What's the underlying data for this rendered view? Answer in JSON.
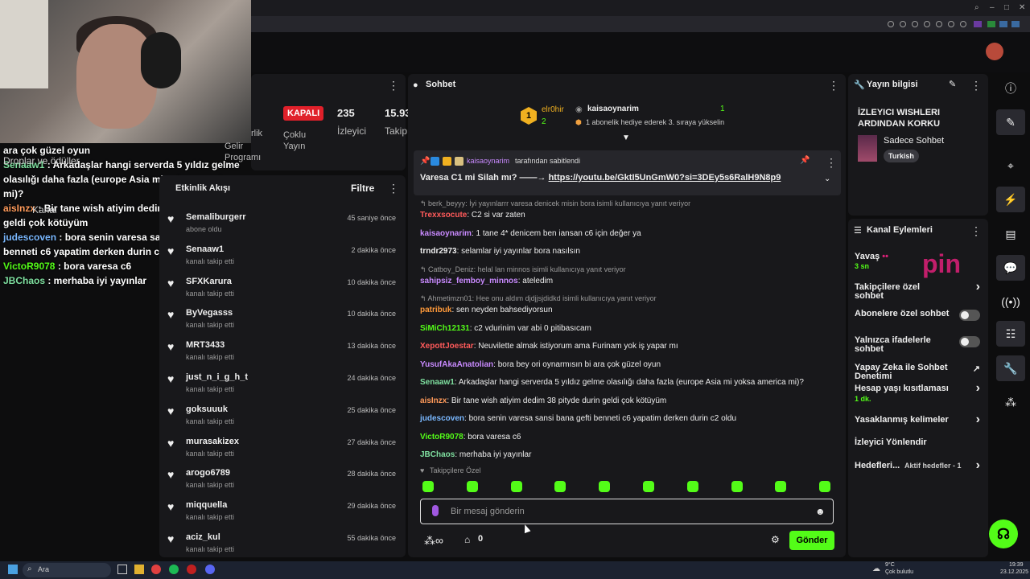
{
  "overlay_chat": [
    {
      "user": "",
      "text": "ara çok güzel oyun",
      "color": "#ffffff"
    },
    {
      "user": "Senaaw1",
      "text": " : Arkadaşlar hangi serverda 5 yıldız gelme olasılığı daha fazla (europe Asia mi yoksa america mi)?",
      "color": "#7fe0a0"
    },
    {
      "user": "aisInzx",
      "text": " : Bir tane wish atiyim dedim 38 pityde durin geldi çok kötüyüm",
      "color": "#ff9a5a"
    },
    {
      "user": "judescoven",
      "text": " : bora senin varesa sansi bana gefti benneti c6 yapatim derken durin c2 oldu",
      "color": "#7ab8ff"
    },
    {
      "user": "VictoR9078",
      "text": " : bora varesa c6",
      "color": "#53fc18"
    },
    {
      "user": "JBChaos",
      "text": " : merhaba iyi yayınlar",
      "color": "#7fe0a0"
    }
  ],
  "overlay_under": {
    "drops": "Droplar ve ödüller",
    "kanal": "Kanal"
  },
  "stats": {
    "status": "KAPALI",
    "viewers_num": "235",
    "viewers_label": "İzleyici",
    "followers_num": "15.93",
    "followers_label": "Takip",
    "partial_label": "rlik",
    "cok_label": "Çoklu\nYayın",
    "gelir_label": "Gelir\nProgramı"
  },
  "activity": {
    "title": "Etkinlik Akışı",
    "filter": "Filtre",
    "rows": [
      {
        "name": "Semaliburgerr",
        "sub": "abone oldu",
        "time": "45 saniye önce"
      },
      {
        "name": "Senaaw1",
        "sub": "kanalı takip etti",
        "time": "2 dakika önce"
      },
      {
        "name": "SFXKarura",
        "sub": "kanalı takip etti",
        "time": "10 dakika önce"
      },
      {
        "name": "ByVegasss",
        "sub": "kanalı takip etti",
        "time": "10 dakika önce"
      },
      {
        "name": "MRT3433",
        "sub": "kanalı takip etti",
        "time": "13 dakika önce"
      },
      {
        "name": "just_n_i_g_h_t",
        "sub": "kanalı takip etti",
        "time": "24 dakika önce"
      },
      {
        "name": "goksuuuk",
        "sub": "kanalı takip etti",
        "time": "25 dakika önce"
      },
      {
        "name": "murasakizex",
        "sub": "kanalı takip etti",
        "time": "27 dakika önce"
      },
      {
        "name": "arogo6789",
        "sub": "kanalı takip etti",
        "time": "28 dakika önce"
      },
      {
        "name": "miqquella",
        "sub": "kanalı takip etti",
        "time": "29 dakika önce"
      },
      {
        "name": "aciz_kul",
        "sub": "kanalı takip etti",
        "time": "55 dakika önce"
      }
    ]
  },
  "chat": {
    "title": "Sohbet",
    "top_gifter": "elr0hir",
    "top_gifter_count": "2",
    "gift_user": "kaisaoynarim",
    "gift_count": "1",
    "gift_text": "1 abonelik hediye ederek 3. sıraya yükselin",
    "pinned_by": "kaisaoynarim",
    "pinned_by_suffix": " tarafından sabitlendi",
    "pinned_text": "Varesa C1 mi Silah mı? ——→ ",
    "pinned_link": "https://youtu.be/GktI5UnGmW0?si=3DEy5s6RalH9N8p9",
    "messages": [
      {
        "type": "reply",
        "text": "berk_beyyy: İyi yayınlarrr varesa denicek misin bora isimli kullanıcıya yanıt veriyor"
      },
      {
        "type": "msg",
        "user": "Trexxsocute",
        "color": "#ff5a5a",
        "text": ": C2 si var zaten"
      },
      {
        "type": "msg",
        "user": "kaisaoynarim",
        "color": "#c98aff",
        "text": ": 1 tane 4* denicem ben iansan c6 için değer ya"
      },
      {
        "type": "msg",
        "user": "trndr2973",
        "color": "#eeeeee",
        "text": ": selamlar iyi yayınlar bora nasılsın"
      },
      {
        "type": "reply",
        "text": "Catboy_Deniz: helal lan minnos isimli kullanıcıya yanıt veriyor"
      },
      {
        "type": "msg",
        "user": "sahipsiz_femboy_minnos",
        "color": "#c98aff",
        "text": ": ateledim"
      },
      {
        "type": "reply",
        "text": "Ahmetimzn01: Hee onu aldım djdjjsjdidkd isimli kullanıcıya yanıt veriyor"
      },
      {
        "type": "msg",
        "user": "patribuk",
        "color": "#ff9a3a",
        "text": ": sen neyden bahsediyorsun"
      },
      {
        "type": "msg",
        "user": "SiMiCh12131",
        "color": "#53fc18",
        "text": ": c2 vdurinim var abi 0 pitibasıcam"
      },
      {
        "type": "msg",
        "user": "XepottJoestar",
        "color": "#ff5a5a",
        "text": ": Neuvilette almak istiyorum ama Furinam yok iş yapar mı"
      },
      {
        "type": "msg",
        "user": "YusufAkaAnatolian",
        "color": "#c98aff",
        "text": ": bora bey ori oynarmısın bi ara çok güzel oyun"
      },
      {
        "type": "msg",
        "user": "Senaaw1",
        "color": "#7fe0a0",
        "text": ": Arkadaşlar hangi serverda 5 yıldız gelme olasılığı daha fazla (europe Asia mi yoksa america mi)?"
      },
      {
        "type": "msg",
        "user": "aisInzx",
        "color": "#ff9a5a",
        "text": ": Bir tane wish atiyim dedim 38 pityde durin geldi çok kötüyüm"
      },
      {
        "type": "msg",
        "user": "judescoven",
        "color": "#7ab8ff",
        "text": ": bora senin varesa sansi bana gefti benneti c6 yapatim derken durin c2 oldu"
      },
      {
        "type": "msg",
        "user": "VictoR9078",
        "color": "#53fc18",
        "text": ": bora varesa c6"
      },
      {
        "type": "msg",
        "user": "JBChaos",
        "color": "#7fe0a0",
        "text": ": merhaba iyi yayınlar"
      }
    ],
    "emote_label": "Takipçilere Özel",
    "input_placeholder": "Bir mesaj gönderin",
    "points": "0",
    "send_label": "Gönder"
  },
  "info": {
    "title": "Yayın bilgisi",
    "stream_title": "İZLEYICI WISHLERI ARDINDAN KORKU",
    "category": "Sadece Sohbet",
    "tag": "Turkish"
  },
  "kanal": {
    "title": "Kanal Eylemleri",
    "slow_label": "Yavaş ",
    "slow_value": "3 sn",
    "rows": [
      {
        "label": "Takipçilere özel sohbet",
        "kind": "chev"
      },
      {
        "label": "Abonelere özel sohbet",
        "kind": "toggle"
      },
      {
        "label": "Yalnızca ifadelerle sohbet",
        "kind": "toggle"
      },
      {
        "label": "Yapay Zeka ile Sohbet Denetimi",
        "kind": "ext"
      },
      {
        "label": "Hesap yaşı kısıtlaması",
        "kind": "chev",
        "sub": "1 dk."
      },
      {
        "label": "Yasaklanmış kelimeler",
        "kind": "chev"
      },
      {
        "label": "İzleyici Yönlendir",
        "kind": "none"
      },
      {
        "label": "Hedefleri...",
        "kind": "chev",
        "sub": "Aktif hedefler - 1"
      }
    ],
    "watermark": "pin"
  },
  "taskbar": {
    "search": "Ara",
    "temp": "9°C",
    "weather": "Çok bulutlu",
    "time": "19:39",
    "date": "23.12.2025"
  },
  "colors": {
    "accent": "#53fc18",
    "panel": "#18181b",
    "bg": "#0d0d0e",
    "offline": "#e0202a"
  }
}
